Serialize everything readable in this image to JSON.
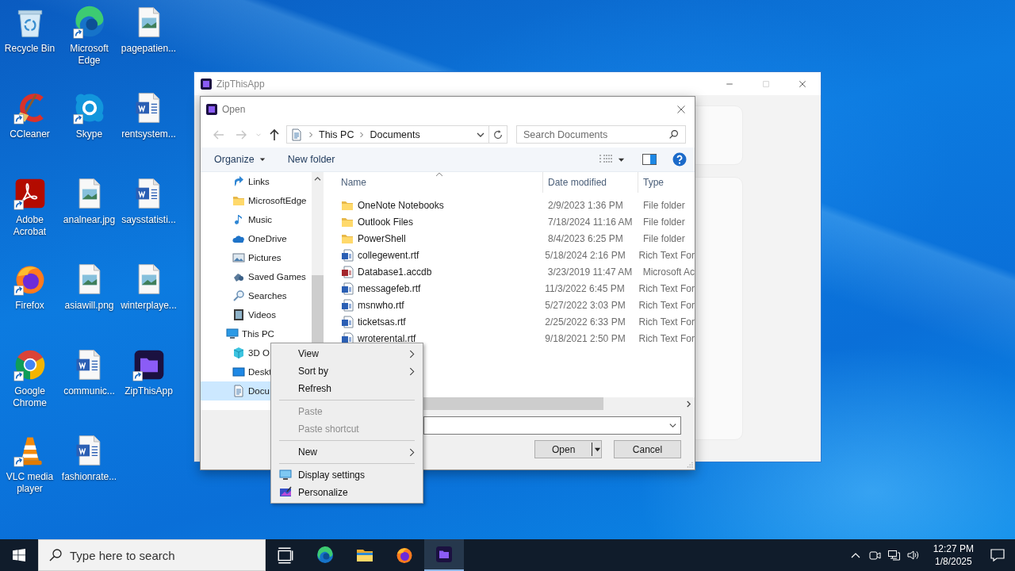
{
  "desktop_icons": [
    {
      "label": "Recycle Bin",
      "kind": "recycle",
      "shortcut": false
    },
    {
      "label": "Microsoft Edge",
      "kind": "edge",
      "shortcut": true
    },
    {
      "label": "pagepatien...",
      "kind": "image",
      "shortcut": false
    },
    {
      "label": "CCleaner",
      "kind": "ccleaner",
      "shortcut": true
    },
    {
      "label": "Skype",
      "kind": "skype",
      "shortcut": true
    },
    {
      "label": "rentsystem...",
      "kind": "word",
      "shortcut": false
    },
    {
      "label": "Adobe Acrobat",
      "kind": "acrobat",
      "shortcut": true
    },
    {
      "label": "analnear.jpg",
      "kind": "image",
      "shortcut": false
    },
    {
      "label": "saysstatisti...",
      "kind": "word",
      "shortcut": false
    },
    {
      "label": "Firefox",
      "kind": "firefox",
      "shortcut": true
    },
    {
      "label": "asiawill.png",
      "kind": "image",
      "shortcut": false
    },
    {
      "label": "winterplaye...",
      "kind": "image",
      "shortcut": false
    },
    {
      "label": "Google Chrome",
      "kind": "chrome",
      "shortcut": true
    },
    {
      "label": "communic...",
      "kind": "word",
      "shortcut": false
    },
    {
      "label": "ZipThisApp",
      "kind": "zip",
      "shortcut": true
    },
    {
      "label": "VLC media player",
      "kind": "vlc",
      "shortcut": true
    },
    {
      "label": "fashionrate...",
      "kind": "word",
      "shortcut": false
    }
  ],
  "app_window": {
    "title": "ZipThisApp",
    "buttons": [
      {
        "kind": "minimize",
        "disabled": false
      },
      {
        "kind": "maximize",
        "disabled": true
      },
      {
        "kind": "close",
        "disabled": false
      }
    ]
  },
  "dialog": {
    "title": "Open",
    "nav_buttons": [
      {
        "kind": "back",
        "disabled": true
      },
      {
        "kind": "forward",
        "disabled": true
      },
      {
        "kind": "recent",
        "disabled": true
      },
      {
        "kind": "up",
        "disabled": false
      }
    ],
    "breadcrumb": [
      "This PC",
      "Documents"
    ],
    "search": {
      "placeholder": "Search Documents"
    },
    "toolbar": [
      {
        "label": "Organize",
        "dropdown": true
      },
      {
        "label": "New folder",
        "dropdown": false
      }
    ],
    "nav": [
      {
        "label": "Links",
        "kind": "links",
        "selected": false
      },
      {
        "label": "MicrosoftEdge",
        "kind": "folder",
        "selected": false
      },
      {
        "label": "Music",
        "kind": "music",
        "selected": false
      },
      {
        "label": "OneDrive",
        "kind": "onedrive",
        "selected": false
      },
      {
        "label": "Pictures",
        "kind": "pictures",
        "selected": false
      },
      {
        "label": "Saved Games",
        "kind": "games",
        "selected": false
      },
      {
        "label": "Searches",
        "kind": "search",
        "selected": false
      },
      {
        "label": "Videos",
        "kind": "videos",
        "selected": false
      },
      {
        "label": "This PC",
        "kind": "pc",
        "selected": false,
        "children": [
          {
            "label": "3D O",
            "kind": "cube",
            "selected": false
          },
          {
            "label": "Deskt",
            "kind": "desktop",
            "selected": false
          },
          {
            "label": "Docu",
            "kind": "documents",
            "selected": true
          }
        ]
      }
    ],
    "files": {
      "columns": [
        "Name",
        "Date modified",
        "Type"
      ],
      "rows": [
        {
          "name": "OneNote Notebooks",
          "date": "2/9/2023 1:36 PM",
          "type": "File folder",
          "kind": "folder"
        },
        {
          "name": "Outlook Files",
          "date": "7/18/2024 11:16 AM",
          "type": "File folder",
          "kind": "folder"
        },
        {
          "name": "PowerShell",
          "date": "8/4/2023 6:25 PM",
          "type": "File folder",
          "kind": "folder"
        },
        {
          "name": "collegewent.rtf",
          "date": "5/18/2024 2:16 PM",
          "type": "Rich Text For",
          "kind": "word"
        },
        {
          "name": "Database1.accdb",
          "date": "3/23/2019 11:47 AM",
          "type": "Microsoft Ac",
          "kind": "access"
        },
        {
          "name": "messagefeb.rtf",
          "date": "11/3/2022 6:45 PM",
          "type": "Rich Text For",
          "kind": "word"
        },
        {
          "name": "msnwho.rtf",
          "date": "5/27/2022 3:03 PM",
          "type": "Rich Text For",
          "kind": "word"
        },
        {
          "name": "ticketsas.rtf",
          "date": "2/25/2022 6:33 PM",
          "type": "Rich Text For",
          "kind": "word"
        },
        {
          "name": "wroterental.rtf",
          "date": "9/18/2021 2:50 PM",
          "type": "Rich Text For",
          "kind": "word"
        }
      ]
    },
    "buttons": [
      "Open",
      "Cancel"
    ]
  },
  "context_menu": {
    "items": [
      {
        "kind": "item",
        "label": "View",
        "disabled": false,
        "submenu": true
      },
      {
        "kind": "item",
        "label": "Sort by",
        "disabled": false,
        "submenu": true
      },
      {
        "kind": "item",
        "label": "Refresh",
        "disabled": false,
        "submenu": false
      },
      {
        "kind": "separator"
      },
      {
        "kind": "item",
        "label": "Paste",
        "disabled": true,
        "submenu": false
      },
      {
        "kind": "item",
        "label": "Paste shortcut",
        "disabled": true,
        "submenu": false
      },
      {
        "kind": "separator"
      },
      {
        "kind": "item",
        "label": "New",
        "disabled": false,
        "submenu": true
      },
      {
        "kind": "separator"
      },
      {
        "kind": "display",
        "label": "Display settings",
        "disabled": false,
        "submenu": false
      },
      {
        "kind": "personalize",
        "label": "Personalize",
        "disabled": false,
        "submenu": false
      }
    ]
  },
  "taskbar": {
    "search": {
      "placeholder": "Type here to search"
    },
    "apps": [
      {
        "kind": "taskview",
        "active": false
      },
      {
        "kind": "edge",
        "active": false
      },
      {
        "kind": "explorer",
        "active": false
      },
      {
        "kind": "firefox",
        "active": false
      },
      {
        "kind": "zip",
        "active": true
      }
    ],
    "time": "12:27 PM",
    "date": "1/8/2025"
  }
}
